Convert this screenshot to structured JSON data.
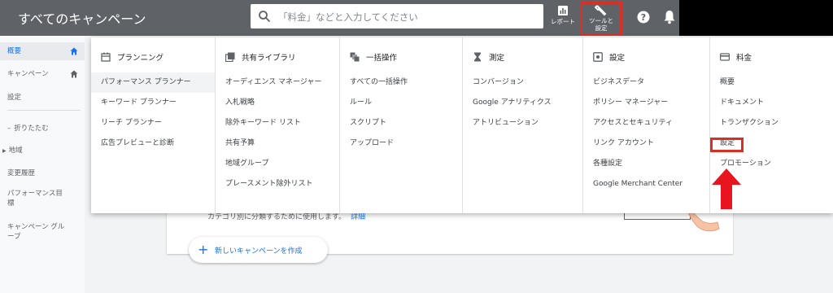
{
  "app": {
    "title": "すべてのキャンペーン"
  },
  "search": {
    "placeholder": "「料金」などと入力してください"
  },
  "toolbar": {
    "report_label": "レポート",
    "tools_label_1": "ツールと",
    "tools_label_2": "設定"
  },
  "leftnav": {
    "items": [
      {
        "label": "概要",
        "active": true
      },
      {
        "label": "キャンペーン"
      },
      {
        "label": "設定"
      },
      {
        "label": "折りたたむ"
      },
      {
        "label": "地域"
      },
      {
        "label": "変更履歴"
      },
      {
        "label": "パフォーマンス目",
        "label2": "標"
      },
      {
        "label": "キャンペーン グル",
        "label2": "ープ"
      }
    ]
  },
  "menu": {
    "columns": [
      {
        "heading": "プランニング",
        "icon": "calendar-icon",
        "items": [
          "パフォーマンス プランナー",
          "キーワード プランナー",
          "リーチ プランナー",
          "広告プレビューと診断"
        ]
      },
      {
        "heading": "共有ライブラリ",
        "icon": "library-icon",
        "items": [
          "オーディエンス マネージャー",
          "入札戦略",
          "除外キーワード リスト",
          "共有予算",
          "地域グループ",
          "プレースメント除外リスト"
        ]
      },
      {
        "heading": "一括操作",
        "icon": "bulk-icon",
        "items": [
          "すべての一括操作",
          "ルール",
          "スクリプト",
          "アップロード"
        ]
      },
      {
        "heading": "測定",
        "icon": "hourglass-icon",
        "items": [
          "コンバージョン",
          "Google アナリティクス",
          "アトリビューション"
        ]
      },
      {
        "heading": "設定",
        "icon": "settings-box-icon",
        "items": [
          "ビジネスデータ",
          "ポリシー マネージャー",
          "アクセスとセキュリティ",
          "リンク アカウント",
          "各種設定",
          "Google Merchant Center"
        ]
      },
      {
        "heading": "料金",
        "icon": "credit-card-icon",
        "items": [
          "概要",
          "ドキュメント",
          "トランザクション",
          "設定",
          "プロモーション"
        ]
      }
    ]
  },
  "card": {
    "text": "カテゴリ別に分類するために使用します。",
    "link": "詳細",
    "new_campaign": "新しいキャンペーンを作成"
  },
  "colors": {
    "topbar": "#5f6368",
    "highlight": "#d93025",
    "accent": "#1a73e8"
  }
}
